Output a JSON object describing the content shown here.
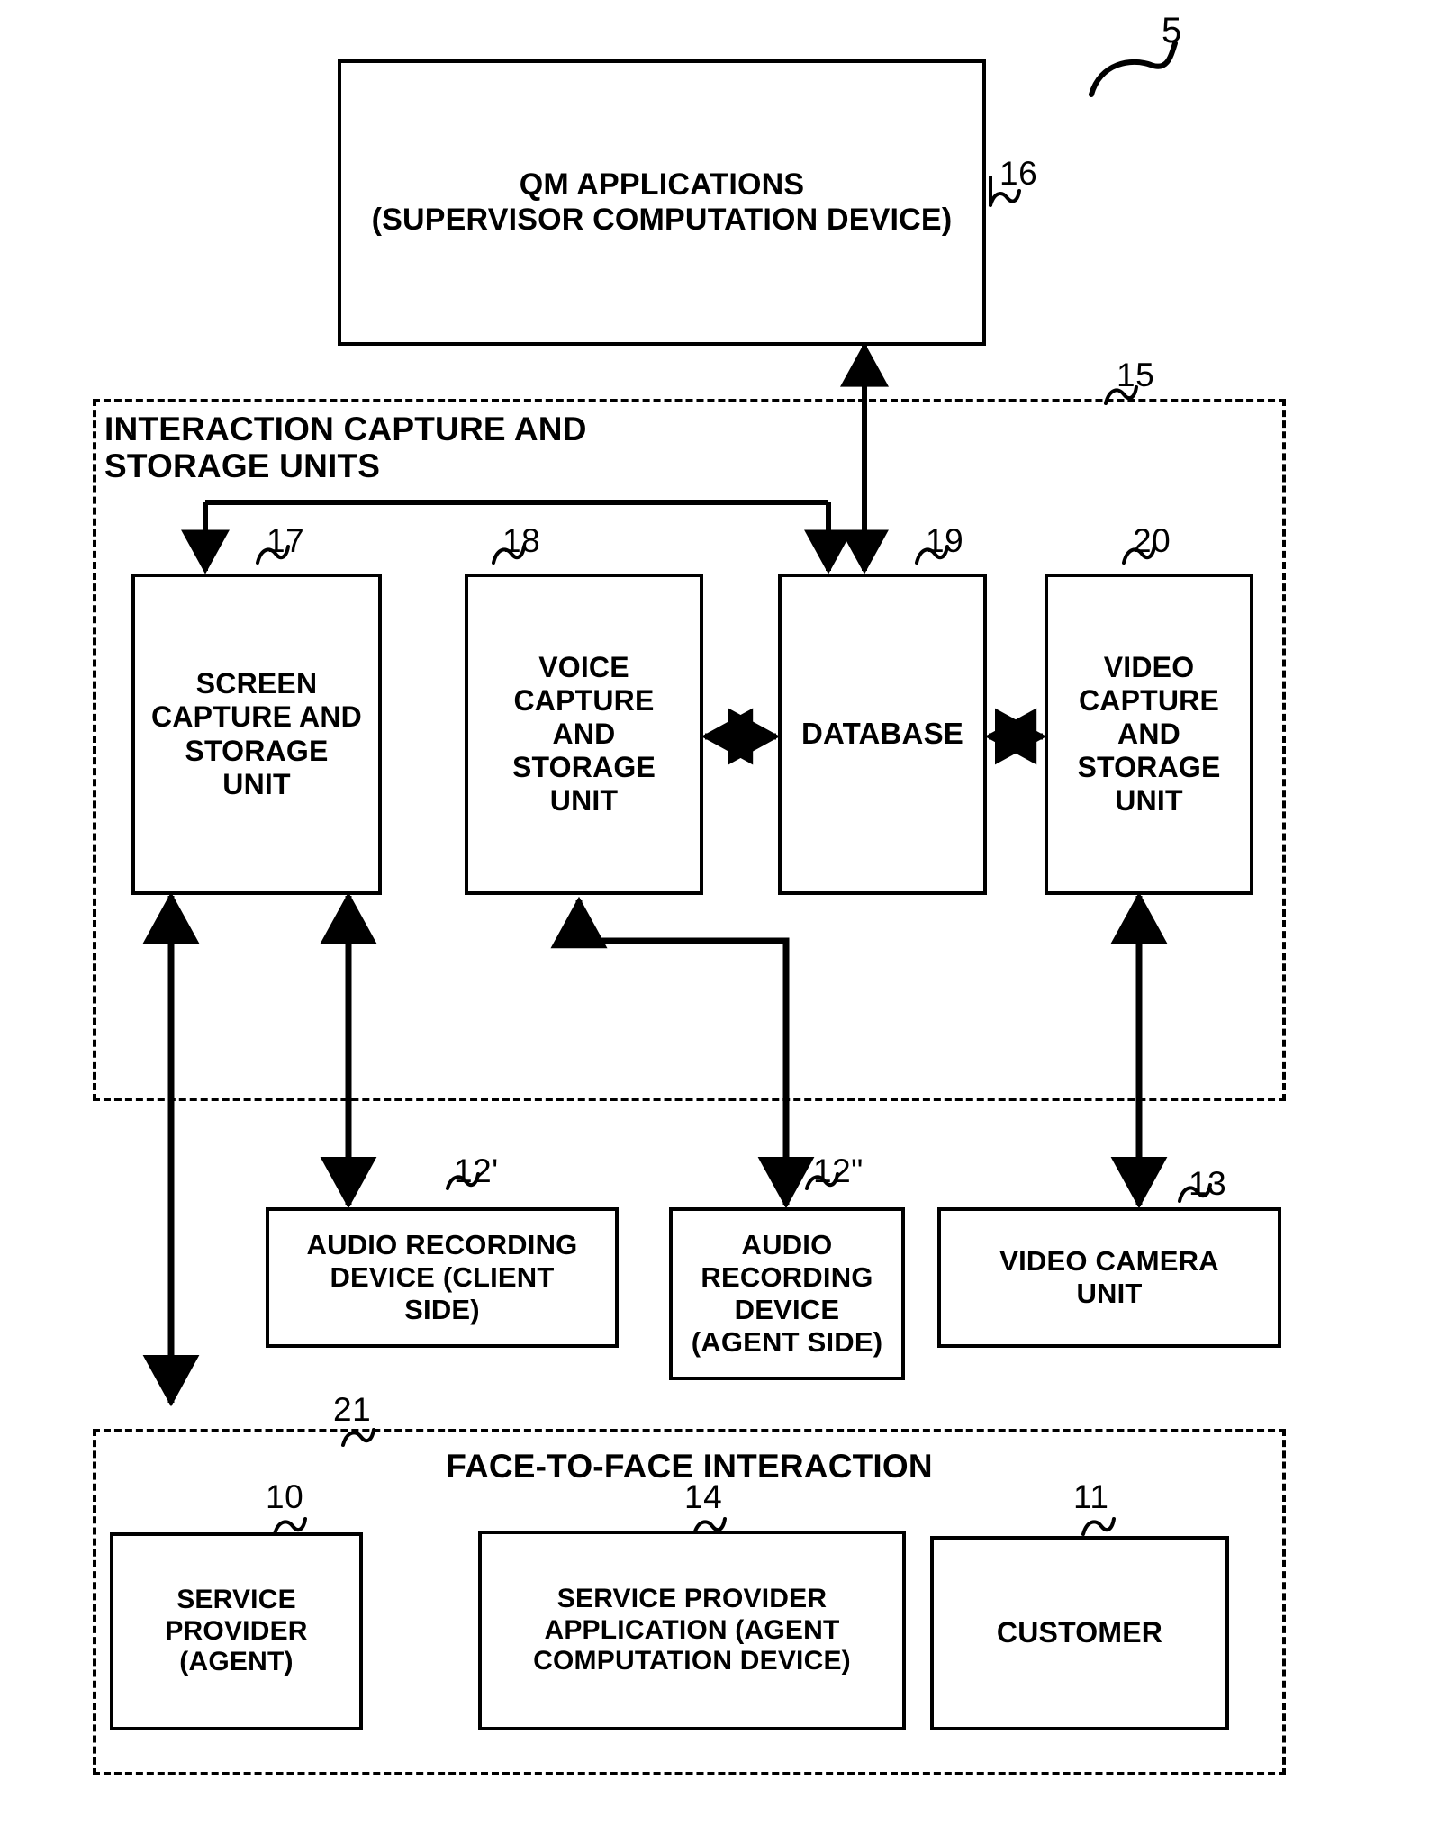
{
  "figure": {
    "figure_number": "5"
  },
  "nodes": {
    "qm_applications": {
      "label": "QM APPLICATIONS\n(SUPERVISOR COMPUTATION DEVICE)",
      "ref": "16"
    },
    "screen_capture": {
      "label": "SCREEN\nCAPTURE AND\nSTORAGE\nUNIT",
      "ref": "17"
    },
    "voice_capture": {
      "label": "VOICE\nCAPTURE\nAND\nSTORAGE\nUNIT",
      "ref": "18"
    },
    "database": {
      "label": "DATABASE",
      "ref": "19"
    },
    "video_capture": {
      "label": "VIDEO\nCAPTURE\nAND\nSTORAGE\nUNIT",
      "ref": "20"
    },
    "audio_client": {
      "label": "AUDIO RECORDING\nDEVICE (CLIENT\nSIDE)",
      "ref": "12'"
    },
    "audio_agent": {
      "label": "AUDIO\nRECORDING\nDEVICE\n(AGENT SIDE)",
      "ref": "12\""
    },
    "video_camera": {
      "label": "VIDEO CAMERA\nUNIT",
      "ref": "13"
    },
    "service_provider": {
      "label": "SERVICE\nPROVIDER (AGENT)",
      "ref": "10"
    },
    "service_provider_app": {
      "label": "SERVICE PROVIDER\nAPPLICATION (AGENT\nCOMPUTATION DEVICE)",
      "ref": "14"
    },
    "customer": {
      "label": "CUSTOMER",
      "ref": "11"
    }
  },
  "regions": {
    "capture_storage": {
      "title": "INTERACTION CAPTURE AND\nSTORAGE UNITS",
      "ref": "15"
    },
    "face_to_face": {
      "title": "FACE-TO-FACE INTERACTION",
      "ref": "21"
    }
  },
  "colors": {
    "line": "#000000",
    "background": "#ffffff"
  }
}
